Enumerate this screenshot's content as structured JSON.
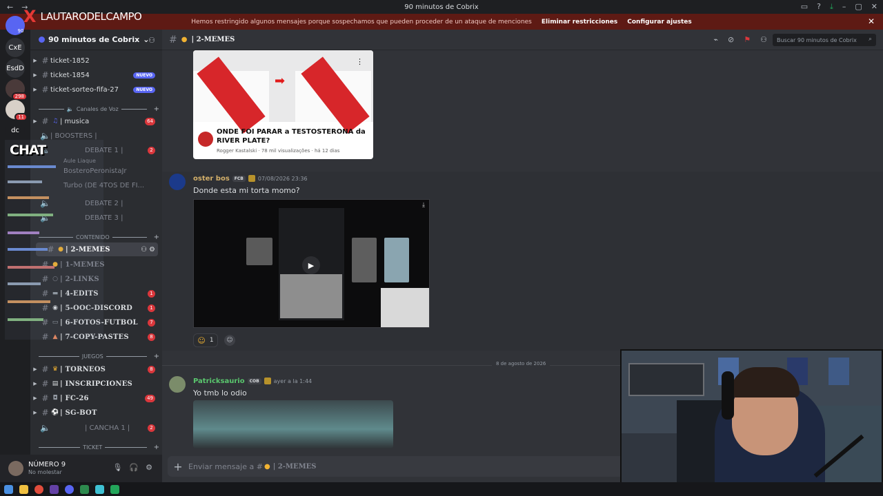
{
  "window": {
    "title": "90 minutos de Cobrix",
    "nav": {
      "back": "←",
      "forward": "→"
    },
    "controls": [
      "▭",
      "?",
      "⤓",
      "–",
      "▢",
      "✕"
    ]
  },
  "overlay": {
    "brand_x": "X",
    "brand_name": "LAUTARODELCAMPO",
    "chat_title": "CHAT"
  },
  "notice": {
    "message": "Hemos restringido algunos mensajes porque sospechamos que pueden proceder de un ataque de menciones",
    "action_remove": "Eliminar restricciones",
    "action_settings": "Configurar ajustes",
    "close": "✕"
  },
  "servers": [
    {
      "label": "90",
      "badge": ""
    },
    {
      "label": "CxE",
      "badge": ""
    },
    {
      "label": "EsdD",
      "badge": ""
    },
    {
      "label": "",
      "badge": "298"
    },
    {
      "label": "",
      "badge": "11"
    },
    {
      "label": "dc",
      "badge": ""
    }
  ],
  "guild": {
    "name": "90 minutos de Cobrix",
    "dropdown": "⌄",
    "add_icon": "⚇"
  },
  "channels": {
    "items": [
      {
        "label": "ticket-1852",
        "count": "",
        "badge": ""
      },
      {
        "label": "ticket-1854",
        "count": "",
        "badge": "NUEVO"
      },
      {
        "label": "ticket-sorteo-fifa-27",
        "count": "",
        "badge": "NUEVO"
      },
      {
        "label": "| musica",
        "count": "64",
        "badge": ""
      },
      {
        "label": "| BOOSTERS |",
        "count": "",
        "badge": ""
      },
      {
        "label": "DEBATE 1 |",
        "count": "2",
        "badge": ""
      },
      {
        "label": "DEBATE 2 |",
        "count": "",
        "badge": ""
      },
      {
        "label": "DEBATE 3 |",
        "count": "",
        "badge": ""
      },
      {
        "label": "| 2-MEMES",
        "count": "",
        "badge": ""
      },
      {
        "label": "| 1-MEMES",
        "count": "",
        "badge": ""
      },
      {
        "label": "| 2-LINKS",
        "count": "",
        "badge": ""
      },
      {
        "label": "| 4-EDITS",
        "count": "1",
        "badge": ""
      },
      {
        "label": "| 5-OOC-DISCORD",
        "count": "1",
        "badge": ""
      },
      {
        "label": "| 6-FOTOS-FUTBOL",
        "count": "7",
        "badge": ""
      },
      {
        "label": "| 7-COPY-PASTES",
        "count": "8",
        "badge": ""
      },
      {
        "label": "| TORNEOS",
        "count": "8",
        "badge": ""
      },
      {
        "label": "| INSCRIPCIONES",
        "count": "",
        "badge": ""
      },
      {
        "label": "| FC-26",
        "count": "49",
        "badge": ""
      },
      {
        "label": "| SG-BOT",
        "count": "",
        "badge": ""
      },
      {
        "label": "| CANCHA 1 |",
        "count": "2",
        "badge": ""
      }
    ],
    "voice_users": [
      "BosteroPeronistaJr",
      "Turbo (DE 4TOS DE FI..."
    ],
    "voice_sub": "Aule Liaque",
    "sep_voice": "Canales de Voz",
    "sep_content": "CONTENIDO",
    "sep_games": "JUEGOS",
    "sep_ticket": "TICKET",
    "plus": "+"
  },
  "user": {
    "name": "NÚMERO 9",
    "status": "No molestar",
    "mic_icon": "🎙",
    "headset_icon": "🎧",
    "settings_icon": "⚙"
  },
  "header": {
    "channel": "| 2-MEMES",
    "search_placeholder": "Buscar 90 minutos de Cobrix",
    "search_icon": "⌕"
  },
  "messages": [
    {
      "embed_title": "ONDE FOI PARAR a TESTOSTERONA da RIVER PLATE?",
      "embed_sub": "Rogger Kastalski · 78 mil visualizações · há 12 dias"
    },
    {
      "author": "oster bos",
      "author_tag": "FCB",
      "time": "07/08/2026 23:36",
      "text": "Donde esta mi torta momo?",
      "reaction_count": "1"
    },
    {
      "author": "Patricksaurio",
      "author_tag": "COB",
      "time": "ayer a la 1:44",
      "text": "Yo tmb lo odio"
    }
  ],
  "date_divider": "8 de agosto de 2026",
  "composer": {
    "plus": "+",
    "placeholder": "Enviar mensaje a #",
    "channel": "| 2-MEMES"
  },
  "colors": {
    "accent": "#5865f2",
    "danger": "#da373c",
    "notice_bg": "#5e1a14"
  }
}
